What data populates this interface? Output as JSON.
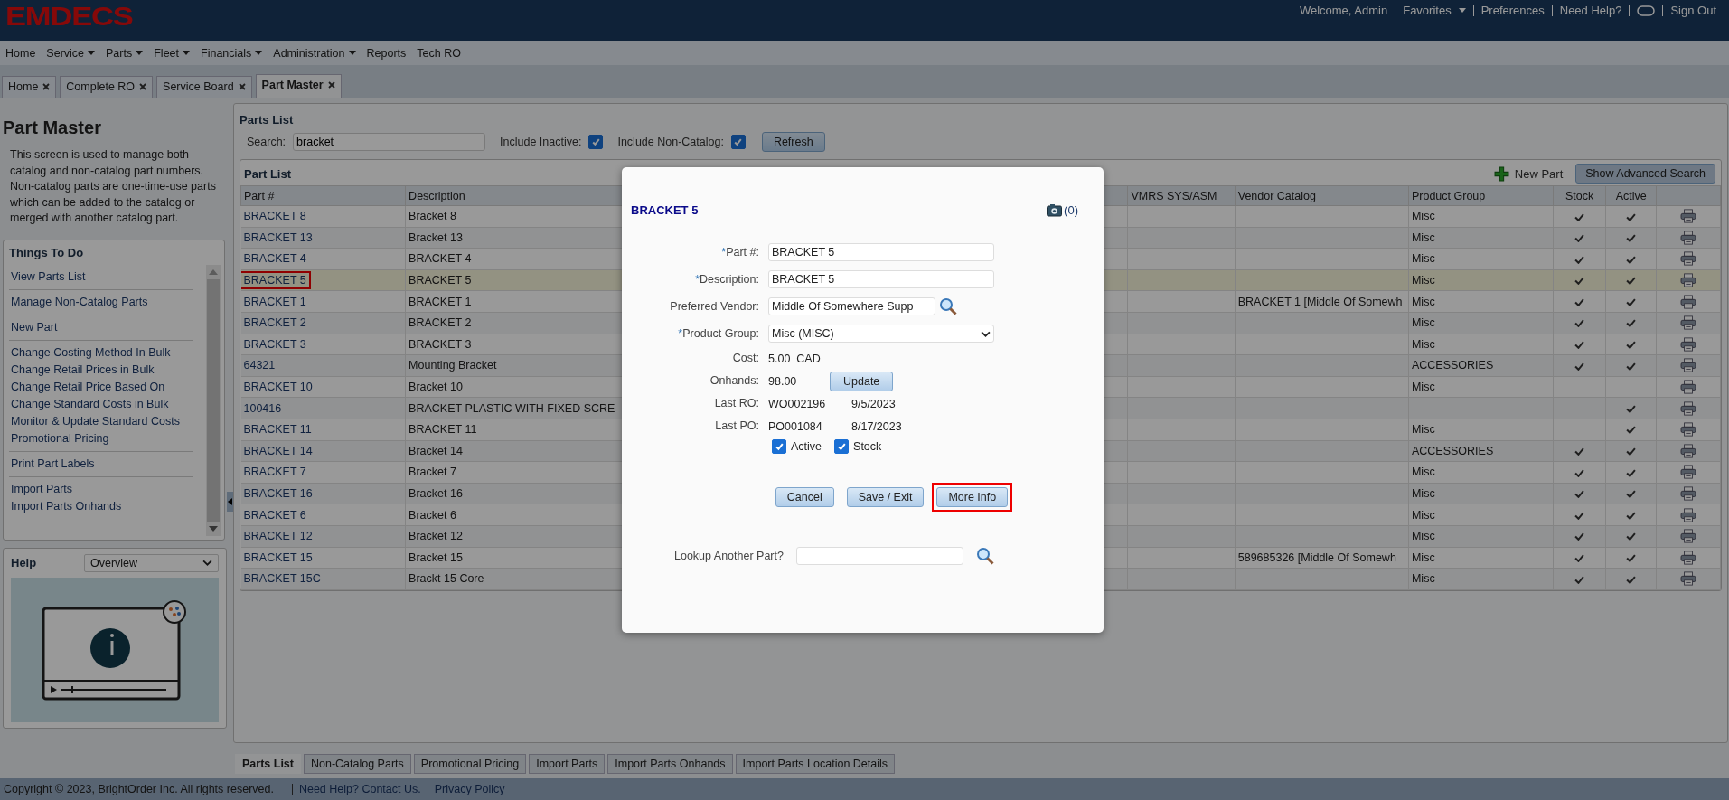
{
  "app": {
    "logo": "EMDECS"
  },
  "header_links": [
    {
      "kind": "text",
      "label": "Welcome, Admin"
    },
    {
      "kind": "menu",
      "label": "Favorites"
    },
    {
      "kind": "link",
      "label": "Preferences"
    },
    {
      "kind": "link",
      "label": "Need Help?"
    },
    {
      "kind": "toggle"
    },
    {
      "kind": "link",
      "label": "Sign Out"
    }
  ],
  "nav": [
    {
      "label": "Home",
      "has_menu": false
    },
    {
      "label": "Service",
      "has_menu": true
    },
    {
      "label": "Parts",
      "has_menu": true
    },
    {
      "label": "Fleet",
      "has_menu": true
    },
    {
      "label": "Financials",
      "has_menu": true
    },
    {
      "label": "Administration",
      "has_menu": true
    },
    {
      "label": "Reports",
      "has_menu": false
    },
    {
      "label": "Tech RO",
      "has_menu": false
    }
  ],
  "tabs": [
    {
      "label": "Home",
      "selected": false
    },
    {
      "label": "Complete RO",
      "selected": false
    },
    {
      "label": "Service Board",
      "selected": false
    },
    {
      "label": "Part Master",
      "selected": true
    }
  ],
  "sidebar": {
    "title": "Part Master",
    "description": "This screen is used to manage both catalog and non-catalog part numbers. Non-catalog parts are one-time-use parts which can be added to the catalog or merged with another catalog part.",
    "todo": {
      "title": "Things To Do",
      "groups": [
        [
          "View Parts List"
        ],
        [
          "Manage Non-Catalog Parts"
        ],
        [
          "New Part"
        ],
        [
          "Change Costing Method In Bulk",
          "Change Retail Prices in Bulk",
          "Change Retail Price Based On",
          "Change Standard Costs in Bulk",
          "Monitor & Update Standard Costs",
          "Promotional Pricing"
        ],
        [
          "Print Part Labels"
        ],
        [
          "Import Parts",
          "Import Parts Onhands"
        ]
      ]
    },
    "help": {
      "title": "Help",
      "select": "Overview"
    }
  },
  "parts_list": {
    "title": "Parts List",
    "search_label": "Search:",
    "search_value": "bracket",
    "filters": [
      {
        "label": "Include Inactive:",
        "checked": true
      },
      {
        "label": "Include Non-Catalog:",
        "checked": true
      }
    ],
    "refresh": "Refresh"
  },
  "part_list": {
    "title": "Part List",
    "new_part": "New Part",
    "advanced_search": "Show Advanced Search",
    "columns": [
      "Part #",
      "Description",
      "VMRS SYS/ASM",
      "Vendor Catalog",
      "Product Group",
      "Stock",
      "Active"
    ],
    "rows": [
      {
        "part": "BRACKET 8",
        "description": "Bracket 8",
        "product_group": "Misc",
        "stock": true,
        "active": true,
        "selected": false,
        "highlighted": false
      },
      {
        "part": "BRACKET 13",
        "description": "Bracket 13",
        "product_group": "Misc",
        "stock": true,
        "active": true,
        "selected": false,
        "highlighted": false
      },
      {
        "part": "BRACKET 4",
        "description": "BRACKET 4",
        "product_group": "Misc",
        "stock": true,
        "active": true,
        "selected": false,
        "highlighted": false
      },
      {
        "part": "BRACKET 5",
        "description": "BRACKET 5",
        "product_group": "Misc",
        "stock": true,
        "active": true,
        "selected": true,
        "highlighted": true
      },
      {
        "part": "BRACKET 1",
        "description": "BRACKET 1",
        "vendor_catalog": "BRACKET 1 [Middle Of Somewh",
        "product_group": "Misc",
        "stock": true,
        "active": true,
        "selected": false,
        "highlighted": false
      },
      {
        "part": "BRACKET 2",
        "description": "BRACKET 2",
        "product_group": "Misc",
        "stock": true,
        "active": true,
        "selected": false,
        "highlighted": false
      },
      {
        "part": "BRACKET 3",
        "description": "BRACKET 3",
        "product_group": "Misc",
        "stock": true,
        "active": true,
        "selected": false,
        "highlighted": false
      },
      {
        "part": "64321",
        "description": "Mounting Bracket",
        "product_group": "ACCESSORIES",
        "stock": true,
        "active": true,
        "selected": false,
        "highlighted": false
      },
      {
        "part": "BRACKET 10",
        "description": "Bracket 10",
        "product_group": "Misc",
        "stock": false,
        "active": false,
        "selected": false,
        "highlighted": false
      },
      {
        "part": "100416",
        "description": "BRACKET PLASTIC WITH FIXED SCRE",
        "stock": false,
        "active": true,
        "selected": false,
        "highlighted": false
      },
      {
        "part": "BRACKET 11",
        "description": "BRACKET 11",
        "product_group": "Misc",
        "stock": false,
        "active": true,
        "selected": false,
        "highlighted": false
      },
      {
        "part": "BRACKET 14",
        "description": "Bracket 14",
        "product_group": "ACCESSORIES",
        "stock": true,
        "active": true,
        "selected": false,
        "highlighted": false
      },
      {
        "part": "BRACKET 7",
        "description": "Bracket 7",
        "product_group": "Misc",
        "stock": true,
        "active": true,
        "selected": false,
        "highlighted": false
      },
      {
        "part": "BRACKET 16",
        "description": "Bracket 16",
        "product_group": "Misc",
        "stock": true,
        "active": true,
        "selected": false,
        "highlighted": false
      },
      {
        "part": "BRACKET 6",
        "description": "Bracket 6",
        "product_group": "Misc",
        "stock": true,
        "active": true,
        "selected": false,
        "highlighted": false
      },
      {
        "part": "BRACKET 12",
        "description": "Bracket 12",
        "product_group": "Misc",
        "stock": true,
        "active": true,
        "selected": false,
        "highlighted": false
      },
      {
        "part": "BRACKET 15",
        "description": "Bracket 15",
        "vendor_catalog": "589685326 [Middle Of Somewh",
        "product_group": "Misc",
        "stock": true,
        "active": true,
        "selected": false,
        "highlighted": false
      },
      {
        "part": "BRACKET 15C",
        "description": "Brackt 15 Core",
        "product_group": "Misc",
        "stock": true,
        "active": true,
        "selected": false,
        "highlighted": false
      }
    ]
  },
  "modal": {
    "title": "BRACKET 5",
    "photo_count": "(0)",
    "fields": [
      {
        "kind": "text",
        "marker": "*",
        "label": "Part #:",
        "value": "BRACKET 5"
      },
      {
        "kind": "text",
        "marker": "*",
        "label": "Description:",
        "value": "BRACKET 5"
      },
      {
        "kind": "lookup",
        "label": "Preferred Vendor:",
        "value": "Middle Of Somewhere Supp"
      },
      {
        "kind": "select",
        "marker": "*",
        "label": "Product Group:",
        "value": "Misc (MISC)"
      }
    ],
    "info": [
      {
        "label": "Cost:",
        "value": "5.00  CAD"
      },
      {
        "label": "Onhands:",
        "value": "98.00",
        "button": "Update"
      },
      {
        "label": "Last RO:",
        "value": "WO002196",
        "date": "9/5/2023"
      },
      {
        "label": "Last PO:",
        "value": "PO001084",
        "date": "8/17/2023"
      }
    ],
    "checks": [
      {
        "label": "Active",
        "checked": true
      },
      {
        "label": "Stock",
        "checked": true
      }
    ],
    "buttons": [
      {
        "label": "Cancel",
        "highlighted": false
      },
      {
        "label": "Save / Exit",
        "highlighted": false
      },
      {
        "label": "More Info",
        "highlighted": true
      }
    ],
    "lookup": {
      "label": "Lookup Another Part?"
    }
  },
  "bottom_tabs": [
    {
      "label": "Parts List",
      "selected": true
    },
    {
      "label": "Non-Catalog Parts",
      "selected": false
    },
    {
      "label": "Promotional Pricing",
      "selected": false
    },
    {
      "label": "Import Parts",
      "selected": false
    },
    {
      "label": "Import Parts Onhands",
      "selected": false
    },
    {
      "label": "Import Parts Location Details",
      "selected": false
    }
  ],
  "footer": {
    "copyright": "Copyright © 2023, BrightOrder Inc. All rights reserved.",
    "links": [
      "Need Help? Contact Us.",
      "Privacy Policy"
    ]
  }
}
